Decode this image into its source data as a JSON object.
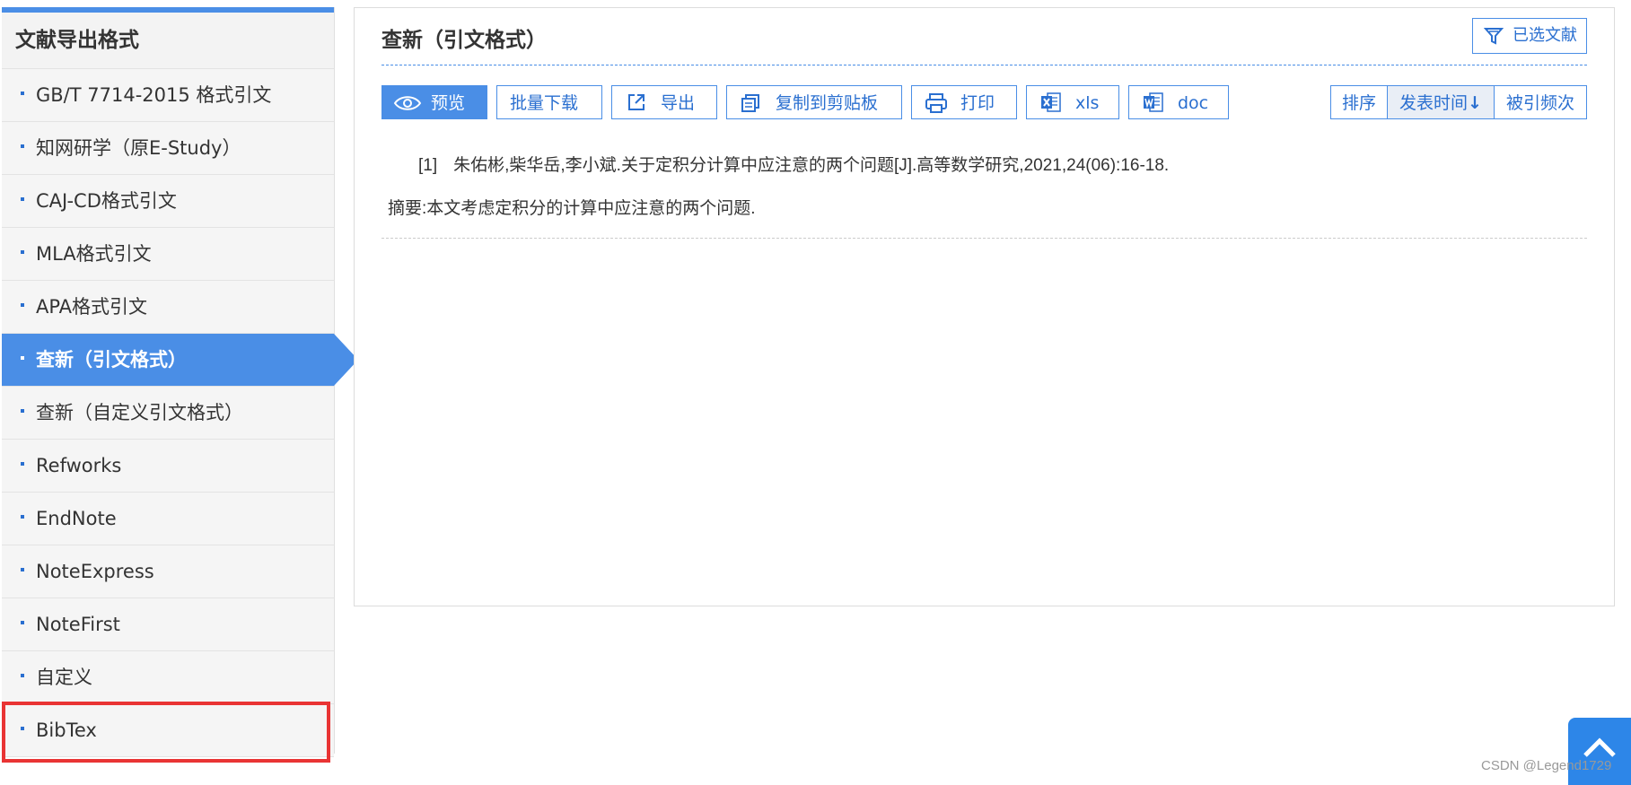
{
  "sidebar": {
    "title": "文献导出格式",
    "items": [
      {
        "label": "GB/T 7714-2015 格式引文"
      },
      {
        "label": "知网研学（原E-Study）"
      },
      {
        "label": "CAJ-CD格式引文"
      },
      {
        "label": "MLA格式引文"
      },
      {
        "label": "APA格式引文"
      },
      {
        "label": "查新（引文格式）",
        "active": true
      },
      {
        "label": "查新（自定义引文格式）"
      },
      {
        "label": "Refworks"
      },
      {
        "label": "EndNote"
      },
      {
        "label": "NoteExpress"
      },
      {
        "label": "NoteFirst"
      },
      {
        "label": "自定义"
      },
      {
        "label": "BibTex"
      }
    ]
  },
  "main": {
    "title": "查新（引文格式）",
    "selected_label": "已选文献",
    "toolbar": {
      "preview": "预览",
      "batch_download": "批量下载",
      "export": "导出",
      "copy": "复制到剪贴板",
      "print": "打印",
      "xls": "xls",
      "doc": "doc"
    },
    "sort": {
      "label": "排序",
      "publish_time": "发表时间",
      "cited": "被引频次"
    },
    "citation": {
      "index": "[1]",
      "text": "朱佑彬,柴华岳,李小斌.关于定积分计算中应注意的两个问题[J].高等数学研究,2021,24(06):16-18."
    },
    "abstract": "摘要:本文考虑定积分的计算中应注意的两个问题."
  },
  "watermark": "CSDN @Legend1729",
  "colors": {
    "accent": "#4a8ee6",
    "highlight": "#e93434"
  }
}
